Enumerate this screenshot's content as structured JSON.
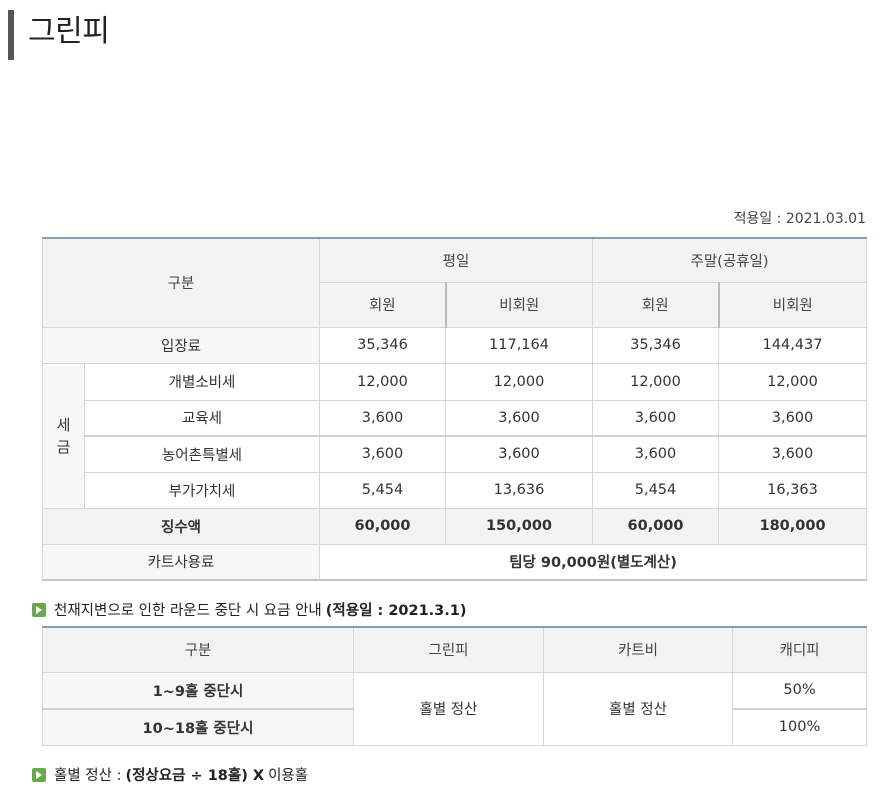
{
  "page": {
    "title": "그린피"
  },
  "fee_table": {
    "apply_date": "적용일 : 2021.03.01",
    "header": {
      "category": "구분",
      "weekday": "평일",
      "weekend": "주말(공휴일)",
      "member": "회원",
      "non_member": "비회원"
    },
    "entrance": {
      "label": "입장료",
      "values": [
        "35,346",
        "117,164",
        "35,346",
        "144,437"
      ]
    },
    "tax_group_label": "세\n금",
    "taxes": [
      {
        "label": "개별소비세",
        "values": [
          "12,000",
          "12,000",
          "12,000",
          "12,000"
        ]
      },
      {
        "label": "교육세",
        "values": [
          "3,600",
          "3,600",
          "3,600",
          "3,600"
        ]
      },
      {
        "label": "농어촌특별세",
        "values": [
          "3,600",
          "3,600",
          "3,600",
          "3,600"
        ]
      },
      {
        "label": "부가가치세",
        "values": [
          "5,454",
          "13,636",
          "5,454",
          "16,363"
        ]
      }
    ],
    "total": {
      "label": "징수액",
      "values": [
        "60,000",
        "150,000",
        "60,000",
        "180,000"
      ]
    },
    "cart": {
      "label": "카트사용료",
      "value": "팀당 90,000원(별도계산)"
    }
  },
  "weather_section": {
    "heading_prefix": "천재지변으로 인한 라운드 중단 시 요금 안내 ",
    "heading_bold": "(적용일 : 2021.3.1)",
    "header": {
      "category": "구분",
      "green_fee": "그린피",
      "cart_fee": "카트비",
      "caddie_fee": "캐디피"
    },
    "rows": [
      {
        "label": "1~9홀 중단시",
        "caddie": "50%"
      },
      {
        "label": "10~18홀 중단시",
        "caddie": "100%"
      }
    ],
    "green_fee_merged": "홀별 정산",
    "cart_fee_merged": "홀별 정산"
  },
  "formula": {
    "prefix": "홀별 정산 : ",
    "bold": "(정상요금 ÷ 18홀) X ",
    "suffix": "이용홀"
  }
}
